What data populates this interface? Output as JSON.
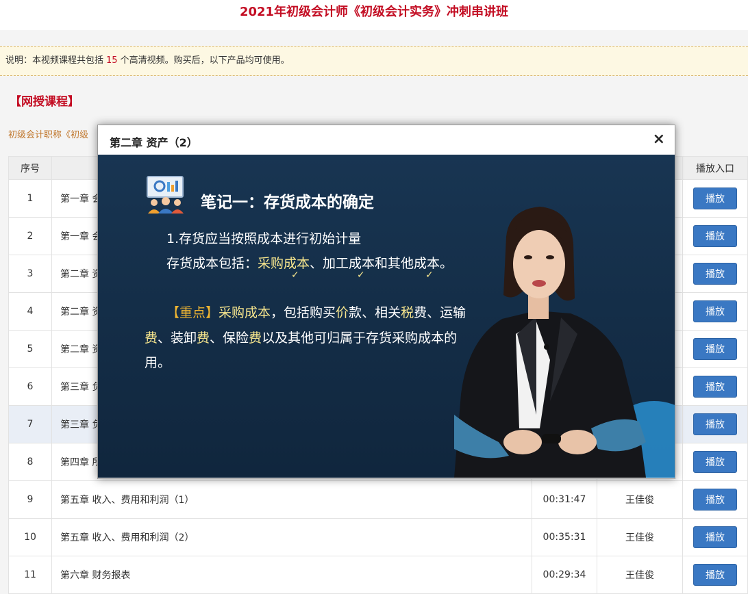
{
  "header": {
    "title": "2021年初级会计师《初级会计实务》冲刺串讲班"
  },
  "notice": {
    "prefix": "说明：本视频课程共包括",
    "count": "15",
    "suffix": "个高清视频。购买后，以下产品均可使用。"
  },
  "section": {
    "title": "【网授课程】",
    "course_line": "初级会计职称《初级"
  },
  "table": {
    "headers": {
      "no": "序号",
      "play": "播放入口"
    },
    "rows": [
      {
        "no": "1",
        "title": "第一章 会",
        "duration": "",
        "teacher": "",
        "play": "播放"
      },
      {
        "no": "2",
        "title": "第一章 会",
        "duration": "",
        "teacher": "",
        "play": "播放"
      },
      {
        "no": "3",
        "title": "第二章 资",
        "duration": "",
        "teacher": "",
        "play": "播放"
      },
      {
        "no": "4",
        "title": "第二章 资",
        "duration": "",
        "teacher": "",
        "play": "播放"
      },
      {
        "no": "5",
        "title": "第二章 资",
        "duration": "",
        "teacher": "",
        "play": "播放"
      },
      {
        "no": "6",
        "title": "第三章 负",
        "duration": "",
        "teacher": "",
        "play": "播放"
      },
      {
        "no": "7",
        "title": "第三章 负",
        "duration": "",
        "teacher": "",
        "play": "播放"
      },
      {
        "no": "8",
        "title": "第四章 所",
        "duration": "",
        "teacher": "",
        "play": "播放"
      },
      {
        "no": "9",
        "title": "第五章 收入、费用和利润（1）",
        "duration": "00:31:47",
        "teacher": "王佳俊",
        "play": "播放"
      },
      {
        "no": "10",
        "title": "第五章 收入、费用和利润（2）",
        "duration": "00:35:31",
        "teacher": "王佳俊",
        "play": "播放"
      },
      {
        "no": "11",
        "title": "第六章 财务报表",
        "duration": "00:29:34",
        "teacher": "王佳俊",
        "play": "播放"
      }
    ]
  },
  "modal": {
    "title": "第二章 资产（2）",
    "close": "×",
    "slide": {
      "heading": "笔记一：存货成本的确定",
      "line1": "1.存货应当按照成本进行初始计量",
      "line2_prefix": "存货成本包括：",
      "line2_hl": "采购成本",
      "line2_suffix": "、加工成本和其他成本。",
      "tick": "✓",
      "line3_tag": "【重点】",
      "line3_hl": "采购成本",
      "line3_a": "，包括购买",
      "line3_b": "价",
      "line3_c": "款、相关",
      "line3_d": "税",
      "line3_e": "费、运输",
      "line4_a": "费",
      "line4_b": "、装卸",
      "line4_c": "费",
      "line4_d": "、保险",
      "line4_e": "费",
      "line4_f": "以及其他可归属于存货采购成本的",
      "line5": "用。"
    }
  },
  "colors": {
    "brand_red": "#c30d23",
    "button_blue": "#3a78c3",
    "slide_bg": "#183552",
    "highlight_yellow": "#f6e58d"
  }
}
